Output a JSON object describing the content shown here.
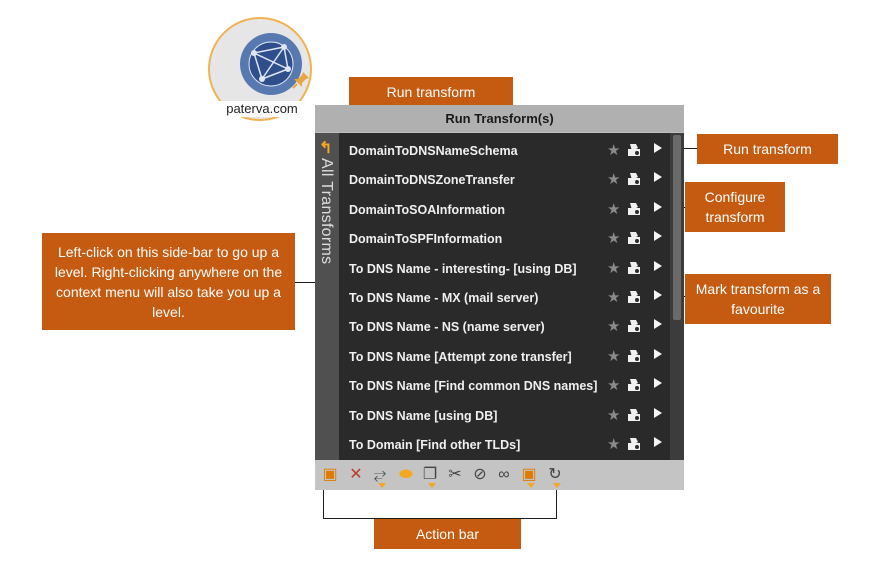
{
  "badge": {
    "label": "paterva.com"
  },
  "panel": {
    "title": "Run Transform(s)",
    "sidebar_label": "All Transforms",
    "transforms": [
      "DomainToDNSNameSchema",
      "DomainToDNSZoneTransfer",
      "DomainToSOAInformation",
      "DomainToSPFInformation",
      "To DNS Name - interesting- [using DB]",
      "To DNS Name - MX (mail server)",
      "To DNS Name - NS (name server)",
      "To DNS Name [Attempt zone transfer]",
      "To DNS Name [Find common DNS names]",
      "To DNS Name [using DB]",
      "To Domain [Find other TLDs]"
    ],
    "action_icons": [
      "add-entity-icon",
      "delete-icon",
      "link-icon",
      "toggle-icon",
      "copy-icon",
      "cut-icon",
      "attach-icon",
      "chain-icon",
      "bookmark-icon",
      "refresh-icon"
    ]
  },
  "callouts": {
    "run_top": "Run transform",
    "run_right": "Run transform",
    "configure": "Configure transform",
    "favourite": "Mark transform as a favourite",
    "sidebar_help": "Left-click on this side-bar to go up a level. Right-clicking anywhere on the context menu will also take you up a level.",
    "action_bar": "Action bar"
  },
  "colors": {
    "callout": "#c55a11",
    "accent": "#f5a623",
    "list_bg": "#2a2a2a"
  }
}
